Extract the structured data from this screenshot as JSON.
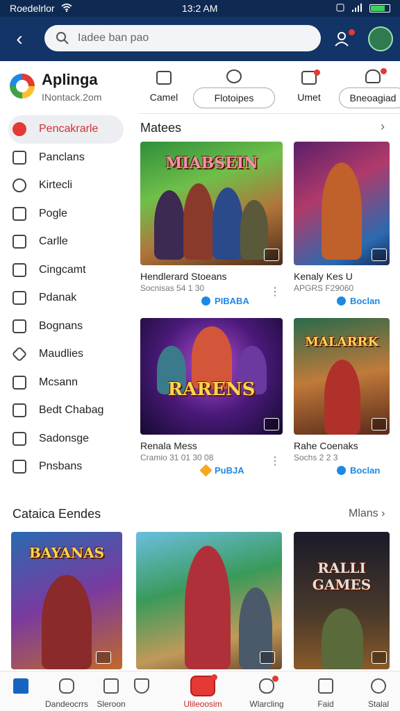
{
  "status_bar": {
    "carrier": "Roedelrlor",
    "time": "13:2 AM"
  },
  "app_bar": {
    "search_placeholder": "Iadee ban pao",
    "back_icon": "back-arrow-icon",
    "user_icon": "user-icon",
    "avatar_icon": "avatar-icon"
  },
  "sidebar": {
    "brand_name": "Aplinga",
    "brand_sub": "INontack.2om",
    "items": [
      {
        "label": "Pencakrarle",
        "icon": "record-icon",
        "active": true
      },
      {
        "label": "Panclans",
        "icon": "gamepad-icon"
      },
      {
        "label": "Kirtecli",
        "icon": "gear-icon"
      },
      {
        "label": "Pogle",
        "icon": "checkbox-icon"
      },
      {
        "label": "Carlle",
        "icon": "square-icon"
      },
      {
        "label": "Cingcamt",
        "icon": "frame-icon"
      },
      {
        "label": "Pdanak",
        "icon": "list-icon"
      },
      {
        "label": "Bognans",
        "icon": "bag-icon"
      },
      {
        "label": "Maudlies",
        "icon": "diamond-icon"
      },
      {
        "label": "Mcsann",
        "icon": "film-icon"
      },
      {
        "label": "Bedt Chabag",
        "icon": "grid-icon"
      },
      {
        "label": "Sadonsge",
        "icon": "shield-icon"
      },
      {
        "label": "Pnsbans",
        "icon": "bracket-icon"
      }
    ]
  },
  "category_tabs": [
    {
      "label": "Camel",
      "icon": "monitor-icon"
    },
    {
      "label": "Flotoipes",
      "icon": "search-icon"
    },
    {
      "label": "Umet",
      "icon": "tv-icon",
      "badge": true
    },
    {
      "label": "Bneoagiad",
      "icon": "cloud-icon",
      "badge": true
    }
  ],
  "sections": {
    "featured_title": "Matees",
    "bottom_title": "Cataica Eendes",
    "bottom_more": "Mlans"
  },
  "featured_cards": [
    {
      "title": "Hendlerard Stoeans",
      "sub": "Socnisas 54 1 30",
      "tag": "PIBABA",
      "tag_style": "blue",
      "art": "MIABSEIN"
    },
    {
      "title": "Kenaly Kes U",
      "sub": "APGRS F29060",
      "tag": "Boclan",
      "tag_style": "blue",
      "art": ""
    },
    {
      "title": "Renala Mess",
      "sub": "Cramio 31 01 30 08",
      "tag": "PuBJA",
      "tag_style": "gold",
      "art": "RARENS"
    },
    {
      "title": "Rahe Coenaks",
      "sub": "Sochs 2 2 3",
      "tag": "Boclan",
      "tag_style": "blue",
      "art": "MALARRK"
    }
  ],
  "bottom_cards": [
    {
      "art": "BAYANAS"
    },
    {
      "art": ""
    },
    {
      "art": "RALLI GAMES"
    }
  ],
  "bottom_nav": [
    {
      "label": "",
      "icon": "home-icon",
      "style": "home"
    },
    {
      "label": "Dandeocrrs",
      "icon": "store-icon"
    },
    {
      "label": "Sleroon",
      "icon": "window-icon"
    },
    {
      "label": "",
      "icon": "shield-icon"
    },
    {
      "label": "Ulileoosim",
      "icon": "gamepad-icon",
      "style": "center"
    },
    {
      "label": "Wlarcling",
      "icon": "chat-icon"
    },
    {
      "label": "Faid",
      "icon": "bookmark-icon"
    },
    {
      "label": "Stalal",
      "icon": "profile-icon"
    }
  ]
}
